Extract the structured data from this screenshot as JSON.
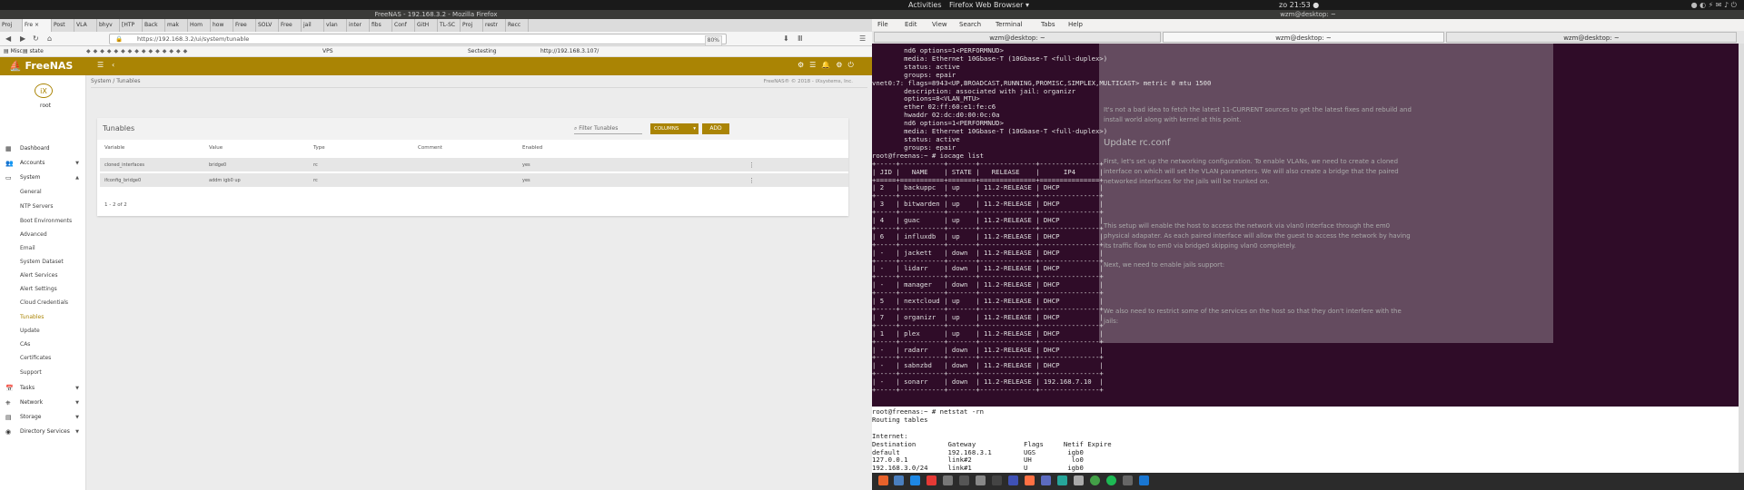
{
  "gnome": {
    "activities": "Activities",
    "app": "Firefox Web Browser ▾",
    "clock": "zo 21:53 ●",
    "user": "wzm@desktop: ~"
  },
  "firefox": {
    "title": "FreeNAS - 192.168.3.2 - Mozilla Firefox",
    "tabs": [
      "Proj",
      "Fre ×",
      "Post",
      "VLA",
      "bhyv",
      "[HTP",
      "Back",
      "mak",
      "Hom",
      "how",
      "Free",
      "SOLV",
      "Free",
      "jail",
      "vlan",
      "inter",
      "fibs",
      "Conf",
      "GitH",
      "TL-SC",
      "Proj",
      "restr",
      "Recc"
    ],
    "url": "https://192.168.3.2/ui/system/tunable",
    "zoom": "80%",
    "bookmarks": {
      "misc": "Misc",
      "state": "state",
      "vps": "VPS",
      "sectesting": "Sectesting",
      "url": "http://192.168.3.107/"
    }
  },
  "freenas": {
    "logo": "FreeNAS",
    "user": "root",
    "breadcrumb": "System / Tunables",
    "copyright": "FreeNAS® © 2018 - iXsystems, Inc.",
    "nav": [
      {
        "label": "Dashboard",
        "icon": "▦"
      },
      {
        "label": "Accounts",
        "icon": "👥",
        "arrow": "▼"
      },
      {
        "label": "System",
        "icon": "▭",
        "arrow": "▲"
      },
      {
        "label": "General"
      },
      {
        "label": "NTP Servers"
      },
      {
        "label": "Boot Environments"
      },
      {
        "label": "Advanced"
      },
      {
        "label": "Email"
      },
      {
        "label": "System Dataset"
      },
      {
        "label": "Alert Services"
      },
      {
        "label": "Alert Settings"
      },
      {
        "label": "Cloud Credentials"
      },
      {
        "label": "Tunables"
      },
      {
        "label": "Update"
      },
      {
        "label": "CAs"
      },
      {
        "label": "Certificates"
      },
      {
        "label": "Support"
      },
      {
        "label": "Tasks",
        "icon": "📅",
        "arrow": "▼"
      },
      {
        "label": "Network",
        "icon": "⎈",
        "arrow": "▼"
      },
      {
        "label": "Storage",
        "icon": "▤",
        "arrow": "▼"
      },
      {
        "label": "Directory Services",
        "icon": "◉",
        "arrow": "▼"
      }
    ],
    "card": {
      "title": "Tunables",
      "filter_placeholder": "Filter Tunables",
      "columns_label": "COLUMNS",
      "add_label": "ADD",
      "headers": [
        "Variable",
        "Value",
        "Type",
        "Comment",
        "Enabled"
      ],
      "rows": [
        {
          "variable": "cloned_interfaces",
          "value": "bridge0",
          "type": "rc",
          "comment": "",
          "enabled": "yes"
        },
        {
          "variable": "ifconfig_bridge0",
          "value": "addm igb0 up",
          "type": "rc",
          "comment": "",
          "enabled": "yes"
        }
      ],
      "pager": "1 - 2 of 2"
    },
    "accent": "#aa8404"
  },
  "terminal": {
    "title": "wzm@desktop: ~",
    "menu": [
      "File",
      "Edit",
      "View",
      "Search",
      "Terminal",
      "Tabs",
      "Help"
    ],
    "tabs": [
      "wzm@desktop: ~",
      "wzm@desktop: ~",
      "wzm@desktop: ~"
    ],
    "text": "        nd6 options=1<PERFORMNUD>\n        media: Ethernet 10Gbase-T (10Gbase-T <full-duplex>)\n        status: active\n        groups: epair\nvnet0:7: flags=8943<UP,BROADCAST,RUNNING,PROMISC,SIMPLEX,MULTICAST> metric 0 mtu 1500\n        description: associated with jail: organizr\n        options=8<VLAN_MTU>\n        ether 02:ff:60:e1:fe:c6\n        hwaddr 02:dc:d0:00:0c:0a\n        nd6 options=1<PERFORMNUD>\n        media: Ethernet 10Gbase-T (10Gbase-T <full-duplex>)\n        status: active\n        groups: epair\nroot@freenas:~ # iocage list\n+-----+-----------+-------+--------------+---------------+\n| JID |   NAME    | STATE |   RELEASE    |      IP4      |\n+=====+===========+=======+==============+===============+\n| 2   | backuppc  | up    | 11.2-RELEASE | DHCP          |\n+-----+-----------+-------+--------------+---------------+\n| 3   | bitwarden | up    | 11.2-RELEASE | DHCP          |\n+-----+-----------+-------+--------------+---------------+\n| 4   | guac      | up    | 11.2-RELEASE | DHCP          |\n+-----+-----------+-------+--------------+---------------+\n| 6   | influxdb  | up    | 11.2-RELEASE | DHCP          |\n+-----+-----------+-------+--------------+---------------+\n| -   | jackett   | down  | 11.2-RELEASE | DHCP          |\n+-----+-----------+-------+--------------+---------------+\n| -   | lidarr    | down  | 11.2-RELEASE | DHCP          |\n+-----+-----------+-------+--------------+---------------+\n| -   | manager   | down  | 11.2-RELEASE | DHCP          |\n+-----+-----------+-------+--------------+---------------+\n| 5   | nextcloud | up    | 11.2-RELEASE | DHCP          |\n+-----+-----------+-------+--------------+---------------+\n| 7   | organizr  | up    | 11.2-RELEASE | DHCP          |\n+-----+-----------+-------+--------------+---------------+\n| 1   | plex      | up    | 11.2-RELEASE | DHCP          |\n+-----+-----------+-------+--------------+---------------+\n| -   | radarr    | down  | 11.2-RELEASE | DHCP          |\n+-----+-----------+-------+--------------+---------------+\n| -   | sabnzbd   | down  | 11.2-RELEASE | DHCP          |\n+-----+-----------+-------+--------------+---------------+\n| -   | sonarr    | down  | 11.2-RELEASE | 192.168.7.10  |\n+-----+-----------+-------+--------------+---------------+",
    "lower_text": "root@freenas:~ # netstat -rn\nRouting tables\n\nInternet:\nDestination        Gateway            Flags     Netif Expire\ndefault            192.168.3.1        UGS        igb0\n127.0.0.1          link#2             UH          lo0\n192.168.3.0/24     link#1             U          igb0",
    "bg_heading": "Update rc.conf",
    "bg_para1": "It's not a bad idea to fetch the latest 11-CURRENT sources to get the latest fixes and rebuild and install world along with kernel at this point.",
    "bg_para2": "First, let's set up the networking configuration. To enable VLANs, we need to create a cloned interface on which will set the VLAN parameters. We will also create a bridge that the paired networked interfaces for the jails will be trunked on.",
    "bg_para3": "This setup will enable the host to access the network via vlan0 interface through the em0 physical adapater. As each paired interface will allow the guest to access the network by having its traffic flow to em0 via bridge0 skipping vlan0 completely.",
    "bg_para4": "Next, we need to enable jails support:",
    "bg_para5": "We also need to restrict some of the services on the host so that they don't interfere with the jails:"
  }
}
